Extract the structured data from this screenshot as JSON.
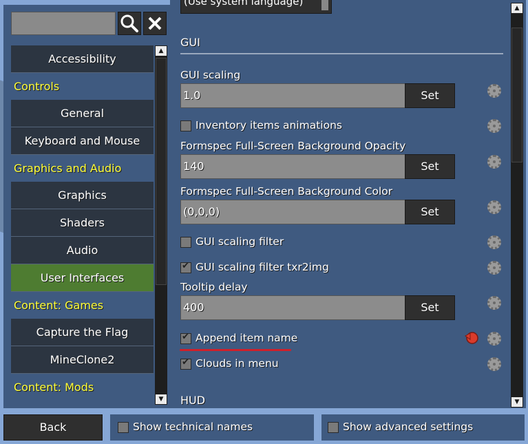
{
  "sidebar": {
    "search": {
      "value": "",
      "placeholder": ""
    },
    "search_icon": "magnifier-icon",
    "clear_icon": "close-icon",
    "items": [
      {
        "label": "Accessibility",
        "kind": "item",
        "selected": false
      },
      {
        "label": "Controls",
        "kind": "header"
      },
      {
        "label": "General",
        "kind": "item",
        "selected": false
      },
      {
        "label": "Keyboard and Mouse",
        "kind": "item",
        "selected": false
      },
      {
        "label": "Graphics and Audio",
        "kind": "header"
      },
      {
        "label": "Graphics",
        "kind": "item",
        "selected": false
      },
      {
        "label": "Shaders",
        "kind": "item",
        "selected": false
      },
      {
        "label": "Audio",
        "kind": "item",
        "selected": false
      },
      {
        "label": "User Interfaces",
        "kind": "item",
        "selected": true
      },
      {
        "label": "Content: Games",
        "kind": "header"
      },
      {
        "label": "Capture the Flag",
        "kind": "item",
        "selected": false
      },
      {
        "label": "MineClone2",
        "kind": "item",
        "selected": false
      },
      {
        "label": "Content: Mods",
        "kind": "header"
      }
    ]
  },
  "main": {
    "partial_top_text": "(Use system language)",
    "section_gui": "GUI",
    "gui_scaling": {
      "label": "GUI scaling",
      "value": "1.0",
      "button": "Set"
    },
    "inventory_animations": {
      "label": "Inventory items animations",
      "checked": false
    },
    "bg_opacity": {
      "label": "Formspec Full-Screen Background Opacity",
      "value": "140",
      "button": "Set"
    },
    "bg_color": {
      "label": "Formspec Full-Screen Background Color",
      "value": "(0,0,0)",
      "button": "Set"
    },
    "scaling_filter": {
      "label": "GUI scaling filter",
      "checked": false
    },
    "scaling_filter_txr2img": {
      "label": "GUI scaling filter txr2img",
      "checked": true
    },
    "tooltip_delay": {
      "label": "Tooltip delay",
      "value": "400",
      "button": "Set"
    },
    "append_item_name": {
      "label": "Append item name",
      "checked": true
    },
    "clouds_in_menu": {
      "label": "Clouds in menu",
      "checked": true
    },
    "section_hud": "HUD",
    "gear_icon": "gear-icon",
    "reset_icon": "reset-icon"
  },
  "bottom": {
    "back_label": "Back",
    "show_technical_names": {
      "label": "Show technical names",
      "checked": false
    },
    "show_advanced_settings": {
      "label": "Show advanced settings",
      "checked": false
    }
  },
  "colors": {
    "header_yellow": "#ffff3a",
    "selected_green": "#4e7c31",
    "panel_blue": "#3f5a80",
    "underline_red": "#d0202a",
    "reset_red": "#d93b2b"
  }
}
